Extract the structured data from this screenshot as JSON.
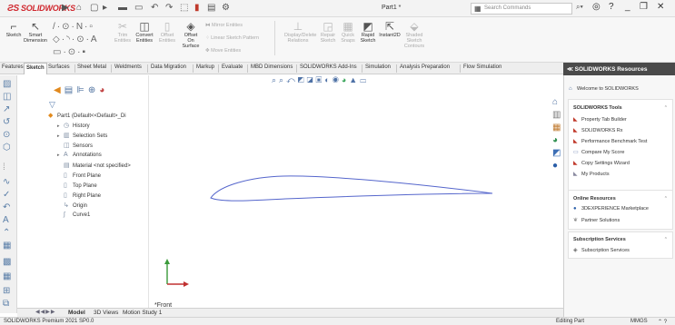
{
  "app": {
    "logo_text": "SOLIDWORKS",
    "document_title": "Part1 *",
    "search_placeholder": "Search Commands"
  },
  "commands": {
    "sketch": "Sketch",
    "smart_dimension": "Smart Dimension",
    "trim_entities": "Trim Entities",
    "convert_entities": "Convert Entities",
    "offset_entities": "Offset Entities",
    "offset_on_surface": "Offset On Surface",
    "mirror_entities": "Mirror Entities",
    "linear_sketch_pattern": "Linear Sketch Pattern",
    "move_entities": "Move Entities",
    "display_delete_relations": "Display/Delete Relations",
    "repair_sketch": "Repair Sketch",
    "quick_snaps": "Quick Snaps",
    "rapid_sketch": "Rapid Sketch",
    "instant2d": "Instant2D",
    "shaded_sketch_contours": "Shaded Sketch Contours"
  },
  "tabs": [
    {
      "label": "Features"
    },
    {
      "label": "Sketch"
    },
    {
      "label": "Surfaces"
    },
    {
      "label": "Sheet Metal"
    },
    {
      "label": "Weldments"
    },
    {
      "label": "Data Migration"
    },
    {
      "label": "Markup"
    },
    {
      "label": "Evaluate"
    },
    {
      "label": "MBD Dimensions"
    },
    {
      "label": "SOLIDWORKS Add-Ins"
    },
    {
      "label": "Simulation"
    },
    {
      "label": "Analysis Preparation"
    },
    {
      "label": "Flow Simulation"
    }
  ],
  "tree": {
    "root": "Part1 (Default<<Default>_Di",
    "items": [
      {
        "label": "History",
        "icon": "history-icon"
      },
      {
        "label": "Selection Sets",
        "icon": "selection-sets-icon"
      },
      {
        "label": "Sensors",
        "icon": "sensor-icon"
      },
      {
        "label": "Annotations",
        "icon": "annotation-icon"
      },
      {
        "label": "Material <not specified>",
        "icon": "material-icon"
      },
      {
        "label": "Front Plane",
        "icon": "plane-icon"
      },
      {
        "label": "Top Plane",
        "icon": "plane-icon"
      },
      {
        "label": "Right Plane",
        "icon": "plane-icon"
      },
      {
        "label": "Origin",
        "icon": "origin-icon"
      },
      {
        "label": "Curve1",
        "icon": "curve-icon"
      }
    ]
  },
  "graphics": {
    "view_label": "*Front",
    "curve_color": "#5566cc"
  },
  "bottom_tabs": [
    {
      "label": "Model"
    },
    {
      "label": "3D Views"
    },
    {
      "label": "Motion Study 1"
    }
  ],
  "status": {
    "left": "SOLIDWORKS Premium 2021 SP0.0",
    "mode": "Editing Part",
    "units": "MMGS"
  },
  "resources": {
    "title": "SOLIDWORKS Resources",
    "welcome": "Welcome to SOLIDWORKS",
    "tools_header": "SOLIDWORKS Tools",
    "tools": [
      "Property Tab Builder",
      "SOLIDWORKS Rx",
      "Performance Benchmark Test",
      "Compare My Score",
      "Copy Settings Wizard",
      "My Products"
    ],
    "online_header": "Online Resources",
    "online": [
      "3DEXPERIENCE Marketplace",
      "Partner Solutions"
    ],
    "subscription_header": "Subscription Services",
    "subscription": [
      "Subscription Services"
    ]
  }
}
